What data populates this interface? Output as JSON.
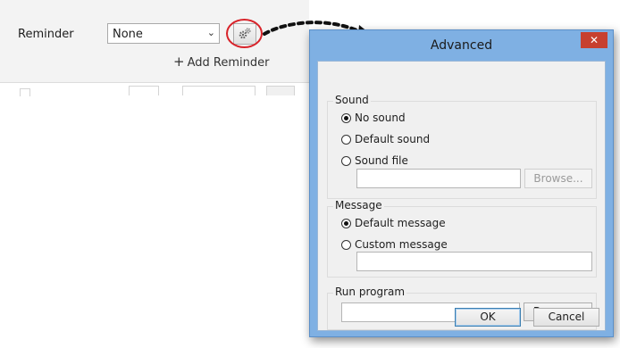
{
  "background": {
    "reminder_label": "Reminder",
    "reminder_value": "None",
    "add_reminder_label": "Add Reminder"
  },
  "dialog": {
    "title": "Advanced",
    "close_glyph": "✕",
    "sound": {
      "group_title": "Sound",
      "options": [
        {
          "label": "No sound",
          "selected": true
        },
        {
          "label": "Default sound",
          "selected": false
        },
        {
          "label": "Sound file",
          "selected": false
        }
      ],
      "file_value": "",
      "browse_label": "Browse..."
    },
    "message": {
      "group_title": "Message",
      "options": [
        {
          "label": "Default message",
          "selected": true
        },
        {
          "label": "Custom message",
          "selected": false
        }
      ],
      "custom_value": ""
    },
    "run_program": {
      "group_title": "Run program",
      "value": "",
      "browse_label": "Browse..."
    },
    "ok_label": "OK",
    "cancel_label": "Cancel"
  },
  "colors": {
    "highlight_circle": "#d8232a",
    "dialog_frame": "#7fb0e3",
    "close_button": "#c7402f"
  },
  "icons": {
    "advanced_button_icon": "gears-icon",
    "close_icon": "close-icon",
    "dropdown_icon": "chevron-down-icon",
    "add_icon": "plus-icon",
    "pointer_arrow": "dashed-arrow"
  }
}
